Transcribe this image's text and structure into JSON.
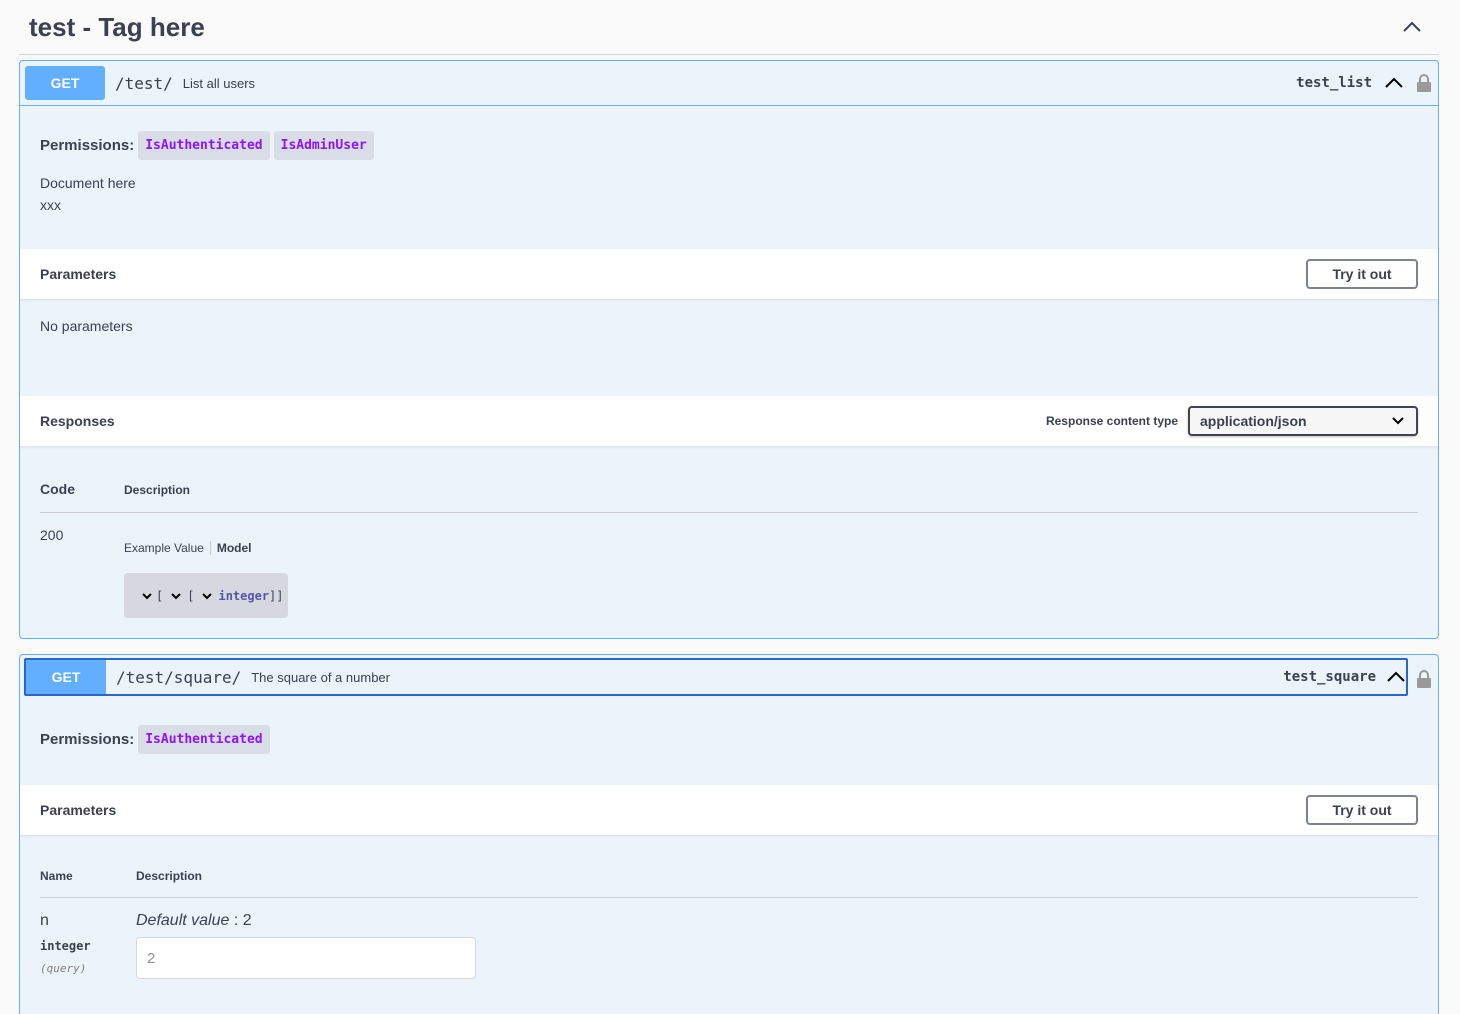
{
  "tag": {
    "title": "test - Tag here"
  },
  "op1": {
    "method": "GET",
    "path": "/test/",
    "summary": "List all users",
    "operation_id": "test_list",
    "permissions_label": "Permissions:",
    "permissions": [
      "IsAuthenticated",
      "IsAdminUser"
    ],
    "doc_line1": "Document here",
    "doc_line2": "xxx",
    "parameters_title": "Parameters",
    "try_label": "Try it out",
    "no_params": "No parameters",
    "responses_title": "Responses",
    "rct_label": "Response content type",
    "rct_value": "application/json",
    "code_header": "Code",
    "desc_header": "Description",
    "code": "200",
    "example_tab": "Example Value",
    "model_tab": "Model",
    "model_bracket1": "[",
    "model_bracket2": "[",
    "model_type": "integer",
    "model_close": "]]"
  },
  "op2": {
    "method": "GET",
    "path": "/test/square/",
    "summary": "The square of a number",
    "operation_id": "test_square",
    "permissions_label": "Permissions:",
    "permissions": [
      "IsAuthenticated"
    ],
    "parameters_title": "Parameters",
    "try_label": "Try it out",
    "name_header": "Name",
    "desc_header": "Description",
    "param_name": "n",
    "param_type": "integer",
    "param_in": "(query)",
    "default_label": "Default value",
    "default_sep": " : ",
    "default_value": "2",
    "input_value": "2"
  },
  "colors": {
    "get": "#61affe",
    "permission_text": "#9012fe",
    "focus": "#2a65c8"
  }
}
